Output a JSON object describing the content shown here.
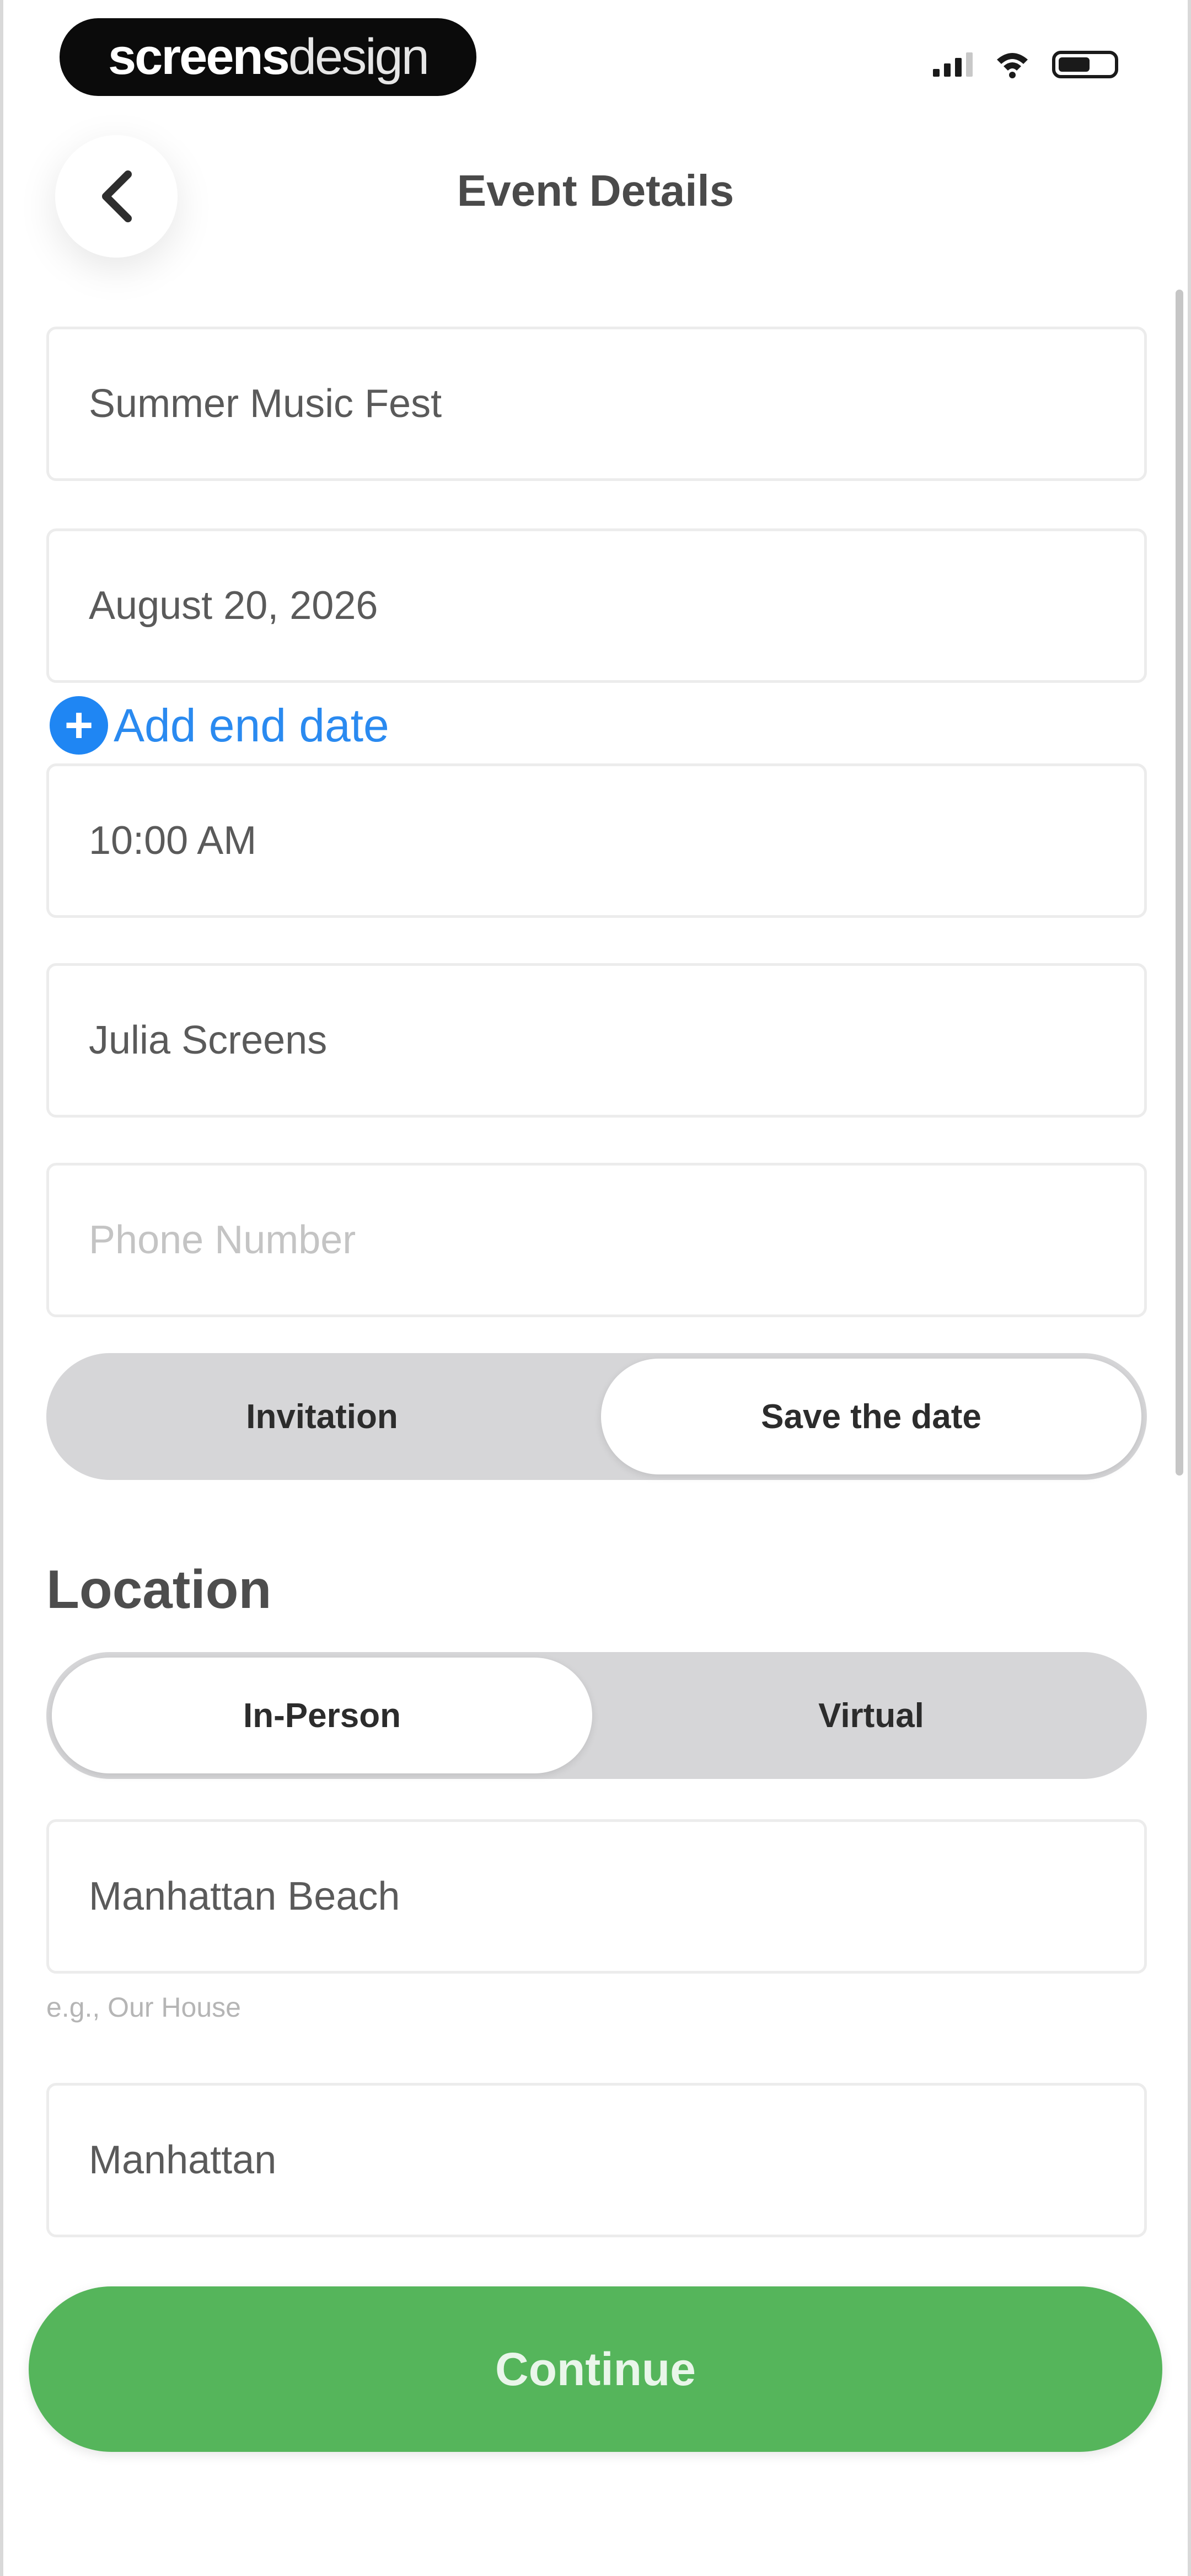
{
  "status_bar": {
    "brand_bold": "screens",
    "brand_light": "design"
  },
  "header": {
    "back_icon": "chevron-left-icon",
    "title": "Event Details"
  },
  "form": {
    "event_name": {
      "value": "Summer Music Fest"
    },
    "date": {
      "value": "August 20, 2026"
    },
    "add_end_date": {
      "label": "Add end date",
      "icon": "plus-circle-icon",
      "color": "#1f86f3"
    },
    "time": {
      "value": "10:00 AM"
    },
    "host_name": {
      "value": "Julia Screens"
    },
    "phone": {
      "placeholder": "Phone Number",
      "value": ""
    },
    "card_type": {
      "options": [
        "Invitation",
        "Save the date"
      ],
      "selected": "Save the date"
    }
  },
  "location": {
    "heading": "Location",
    "mode": {
      "options": [
        "In-Person",
        "Virtual"
      ],
      "selected": "In-Person"
    },
    "venue_name": {
      "value": "Manhattan Beach",
      "hint": "e.g., Our House"
    },
    "city": {
      "value": "Manhattan"
    }
  },
  "actions": {
    "continue_label": "Continue",
    "continue_color": "#55b55b"
  }
}
